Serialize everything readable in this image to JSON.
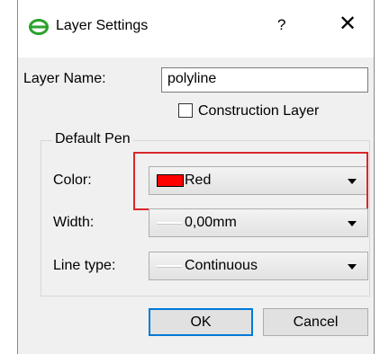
{
  "window": {
    "title": "Layer Settings",
    "help_label": "?",
    "close_label": "✕"
  },
  "layer_name": {
    "label": "Layer Name:",
    "value": "polyline"
  },
  "construction_layer": {
    "label": "Construction Layer",
    "checked": false
  },
  "default_pen": {
    "group_label": "Default Pen",
    "color": {
      "label": "Color:",
      "value": "Red",
      "swatch_color": "#ff0000"
    },
    "width": {
      "label": "Width:",
      "value": "0,00mm"
    },
    "line_type": {
      "label": "Line type:",
      "value": "Continuous"
    }
  },
  "buttons": {
    "ok": "OK",
    "cancel": "Cancel"
  },
  "colors": {
    "highlight": "#d9262b",
    "focus": "#0078d7",
    "icon": "#2aa22a"
  }
}
